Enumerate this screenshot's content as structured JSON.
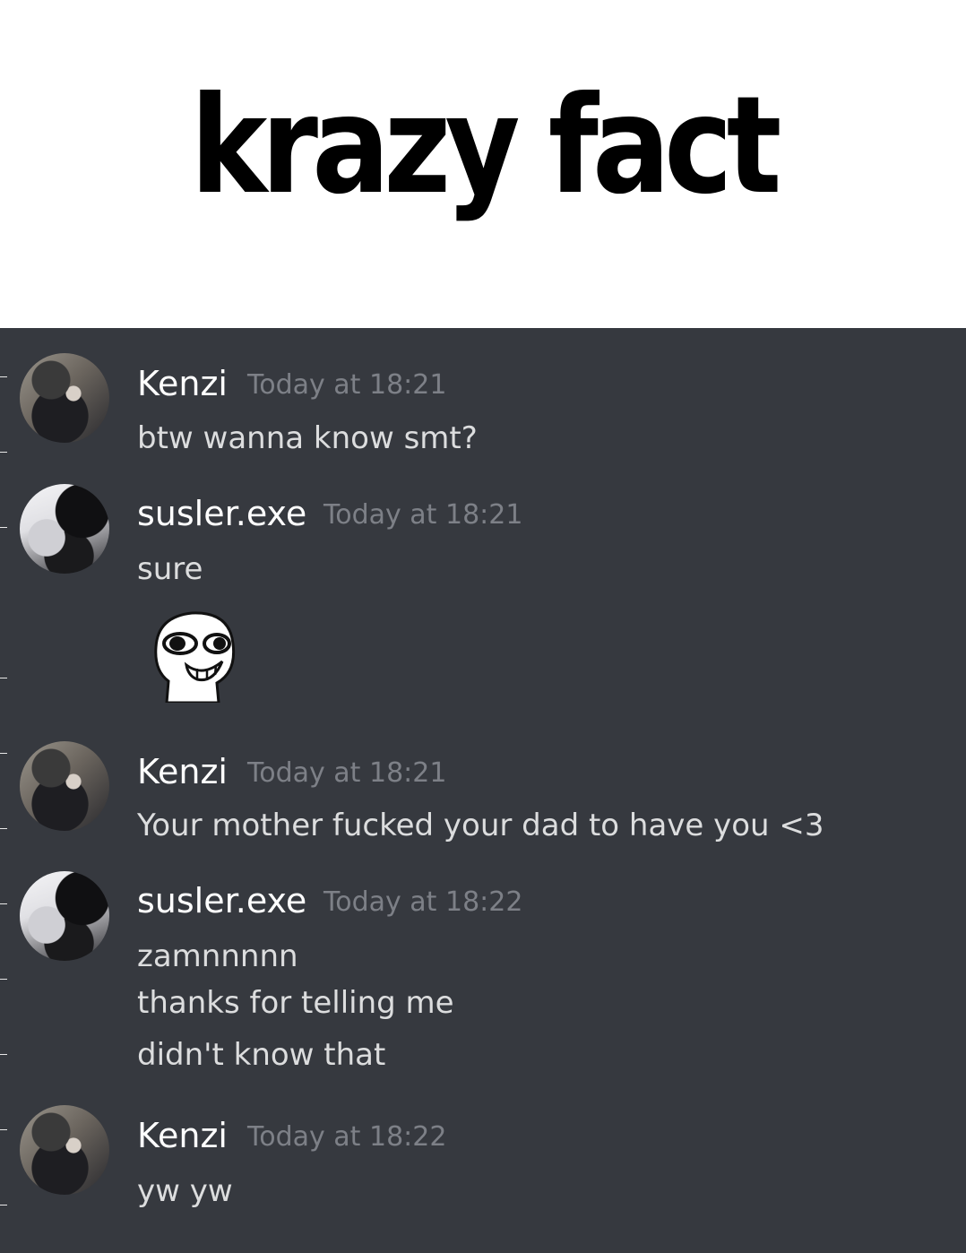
{
  "caption": {
    "text": "krazy fact"
  },
  "messages": [
    {
      "author": "Kenzi",
      "timestamp": "Today at 18:21",
      "lines": [
        "btw wanna know smt?"
      ]
    },
    {
      "author": "susler.exe",
      "timestamp": "Today at 18:21",
      "lines": [
        "sure"
      ],
      "sticker": "grinning-face-sticker"
    },
    {
      "author": "Kenzi",
      "timestamp": "Today at 18:21",
      "lines": [
        "Your mother fucked your dad to have you <3"
      ]
    },
    {
      "author": "susler.exe",
      "timestamp": "Today at 18:22",
      "lines": [
        "zamnnnnn",
        "thanks for telling me",
        "didn't know that"
      ]
    },
    {
      "author": "Kenzi",
      "timestamp": "Today at 18:22",
      "lines": [
        "yw yw"
      ]
    }
  ],
  "colors": {
    "chat_background": "#36393f",
    "username": "#ffffff",
    "timestamp": "#7d8087",
    "message_text": "#dcddde"
  }
}
